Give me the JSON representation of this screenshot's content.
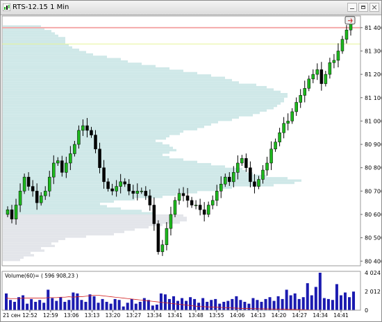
{
  "window": {
    "title": "RTS-12.15 1 Min"
  },
  "price_panel": {
    "y_ticks": [
      "81 400",
      "81 300",
      "81 200",
      "81 100",
      "81 000",
      "80 900",
      "80 800",
      "80 700",
      "80 600",
      "80 500",
      "80 400"
    ]
  },
  "volume_panel": {
    "label": "Volume(60)= ( 596 908,23 )",
    "y_ticks": [
      "4 024",
      "2 012",
      "0"
    ]
  },
  "time_axis": {
    "date_label": "21 сен",
    "labels": [
      "12:52",
      "12:59",
      "13:06",
      "13:13",
      "13:20",
      "13:27",
      "13:34",
      "13:41",
      "13:48",
      "13:55",
      "14:06",
      "14:13",
      "14:20",
      "14:27",
      "14:34",
      "14:41"
    ]
  },
  "colors": {
    "bull": "#1db81d",
    "bear": "#000000",
    "profile_upper": "#cfe8e8",
    "profile_lower": "#e3e5ea",
    "volume_bar": "#1b1bb0",
    "volume_avg": "#d22020",
    "last_price_line": "#f4aaaa",
    "level_line": "#e6f59a"
  },
  "chart_data": [
    {
      "type": "candlestick",
      "title": "RTS-12.15 1 Min",
      "ylim": [
        80380,
        81450
      ],
      "x_ticks": [
        "12:52",
        "12:59",
        "13:06",
        "13:13",
        "13:20",
        "13:27",
        "13:34",
        "13:41",
        "13:48",
        "13:55",
        "14:06",
        "14:13",
        "14:20",
        "14:27",
        "14:34",
        "14:41"
      ],
      "close_path": [
        80620,
        80580,
        80640,
        80700,
        80760,
        80720,
        80700,
        80650,
        80680,
        80700,
        80760,
        80820,
        80830,
        80780,
        80820,
        80860,
        80900,
        80960,
        80980,
        80960,
        80940,
        80880,
        80800,
        80740,
        80710,
        80700,
        80720,
        80740,
        80730,
        80700,
        80690,
        80700,
        80700,
        80680,
        80640,
        80560,
        80440,
        80470,
        80540,
        80600,
        80660,
        80690,
        80680,
        80660,
        80640,
        80640,
        80620,
        80600,
        80640,
        80660,
        80700,
        80730,
        80760,
        80740,
        80780,
        80820,
        80840,
        80800,
        80740,
        80720,
        80750,
        80790,
        80820,
        80880,
        80910,
        80950,
        80990,
        81000,
        81040,
        81080,
        81110,
        81140,
        81180,
        81200,
        81220,
        81160,
        81200,
        81250,
        81260,
        81300,
        81350,
        81390,
        81420
      ]
    },
    {
      "type": "bar",
      "label": "Volume(60)",
      "ylim": [
        0,
        4024
      ],
      "values": [
        1800,
        1100,
        900,
        1400,
        1600,
        700,
        1200,
        900,
        1100,
        800,
        2200,
        1300,
        1000,
        1400,
        900,
        1100,
        1900,
        1800,
        1100,
        900,
        1700,
        1500,
        800,
        1200,
        900,
        700,
        1200,
        1100,
        400,
        800,
        1200,
        700,
        900,
        1300,
        1100,
        500,
        600,
        1800,
        1700,
        1200,
        1500,
        1000,
        1300,
        1000,
        1400,
        1200,
        800,
        1300,
        900,
        1100,
        1200,
        700,
        900,
        1000,
        1200,
        1500,
        1100,
        900,
        700,
        1300,
        1100,
        900,
        1200,
        1400,
        1000,
        1500,
        1200,
        2200,
        1600,
        1800,
        1200,
        1400,
        2900,
        1600,
        2500,
        4024,
        1300,
        1200,
        1100,
        2800,
        1600,
        1900,
        1400,
        2000
      ],
      "avg_line": [
        1300,
        1250,
        1250,
        1250,
        1300,
        1300,
        1300,
        1300,
        1300,
        1300,
        1350,
        1350,
        1350,
        1400,
        1400,
        1450,
        1400,
        1450,
        1450,
        1500,
        1550,
        1600,
        1600,
        1550,
        1500,
        1450,
        1400,
        1350,
        1300,
        1250,
        1200,
        1150,
        1100,
        1050,
        1000,
        950,
        900,
        850,
        800,
        750,
        700,
        650,
        600,
        550,
        500,
        450,
        400,
        380,
        360,
        340,
        320,
        300,
        280,
        260,
        240,
        220,
        200,
        190,
        180,
        170,
        160,
        150,
        140,
        130,
        120,
        110,
        100,
        90,
        80,
        70,
        60,
        50,
        40,
        30,
        20,
        15,
        10,
        8,
        6,
        4,
        2,
        1,
        0
      ]
    },
    {
      "type": "bar",
      "label": "volume-profile",
      "levels_from": 80400,
      "level_step": 10,
      "values": [
        25,
        30,
        45,
        40,
        60,
        55,
        75,
        70,
        80,
        90,
        120,
        160,
        175,
        190,
        210,
        230,
        255,
        265,
        265,
        260,
        220,
        200,
        170,
        150,
        140,
        160,
        190,
        230,
        250,
        280,
        310,
        330,
        390,
        420,
        430,
        410,
        380,
        360,
        350,
        345,
        320,
        300,
        280,
        260,
        240,
        230,
        240,
        250,
        245,
        240,
        230,
        220,
        235,
        240,
        255,
        260,
        280,
        290,
        300,
        310,
        330,
        340,
        360,
        370,
        380,
        390,
        395,
        400,
        405,
        405,
        410,
        410,
        400,
        390,
        380,
        365,
        340,
        330,
        320,
        300,
        280,
        260,
        240,
        220,
        200,
        180,
        170,
        150,
        130,
        120,
        110,
        100,
        95,
        90,
        90,
        90,
        80,
        75,
        70,
        60,
        55
      ]
    }
  ]
}
